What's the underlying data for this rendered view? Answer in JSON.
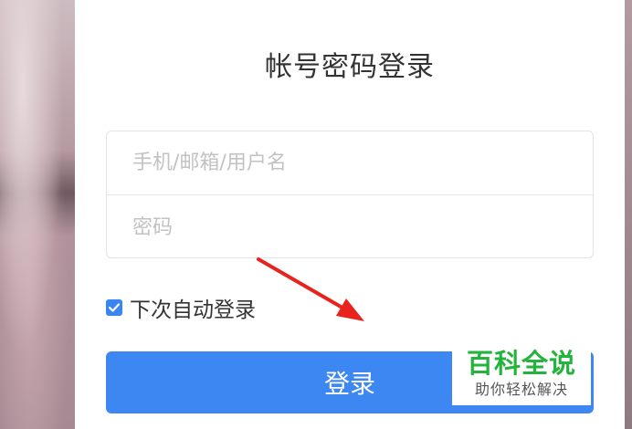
{
  "panel": {
    "title": "帐号密码登录"
  },
  "form": {
    "username_placeholder": "手机/邮箱/用户名",
    "username_value": "",
    "password_placeholder": "密码",
    "password_value": ""
  },
  "remember": {
    "label": "下次自动登录",
    "checked": true
  },
  "login_button": {
    "label": "登录"
  },
  "annotation": {
    "arrow_color": "#e8231d"
  },
  "watermark": {
    "main": "百科全说",
    "sub": "助你轻松解决",
    "main_color": "#24b33c"
  },
  "colors": {
    "accent": "#3c87f1"
  }
}
